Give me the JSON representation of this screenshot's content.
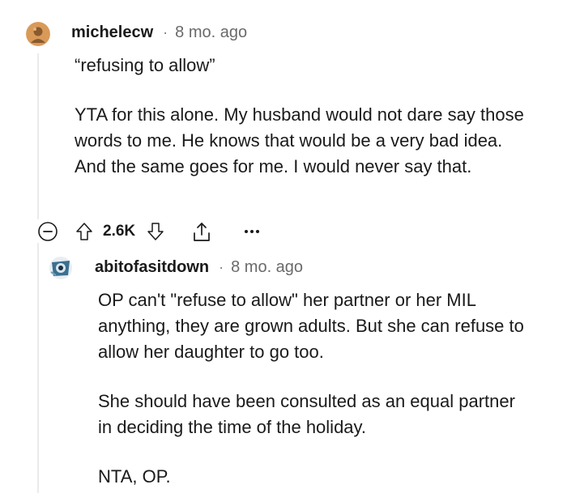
{
  "comments": [
    {
      "username": "michelecw",
      "separator": "·",
      "time": "8 mo. ago",
      "paragraphs": [
        "“refusing to allow”",
        "YTA for this alone. My husband would not dare say those words to me. He knows that would be a very bad idea. And the same goes for me. I would never say that."
      ],
      "score": "2.6K",
      "icons": [
        "collapse-icon",
        "upvote-icon",
        "downvote-icon",
        "share-icon",
        "more-icon"
      ]
    },
    {
      "username": "abitofasitdown",
      "separator": "·",
      "time": "8 mo. ago",
      "paragraphs": [
        "OP can't \"refuse to allow\" her partner or her MIL anything, they are grown adults. But she can refuse to allow her daughter to go too.",
        "She should have been consulted as an equal partner in deciding the time of the holiday.",
        "NTA, OP."
      ]
    }
  ],
  "colors": {
    "text": "#1a1a1b",
    "meta": "#6a6a6a",
    "thread_line": "#e9ebed",
    "avatar_bg": "#d99a58"
  }
}
